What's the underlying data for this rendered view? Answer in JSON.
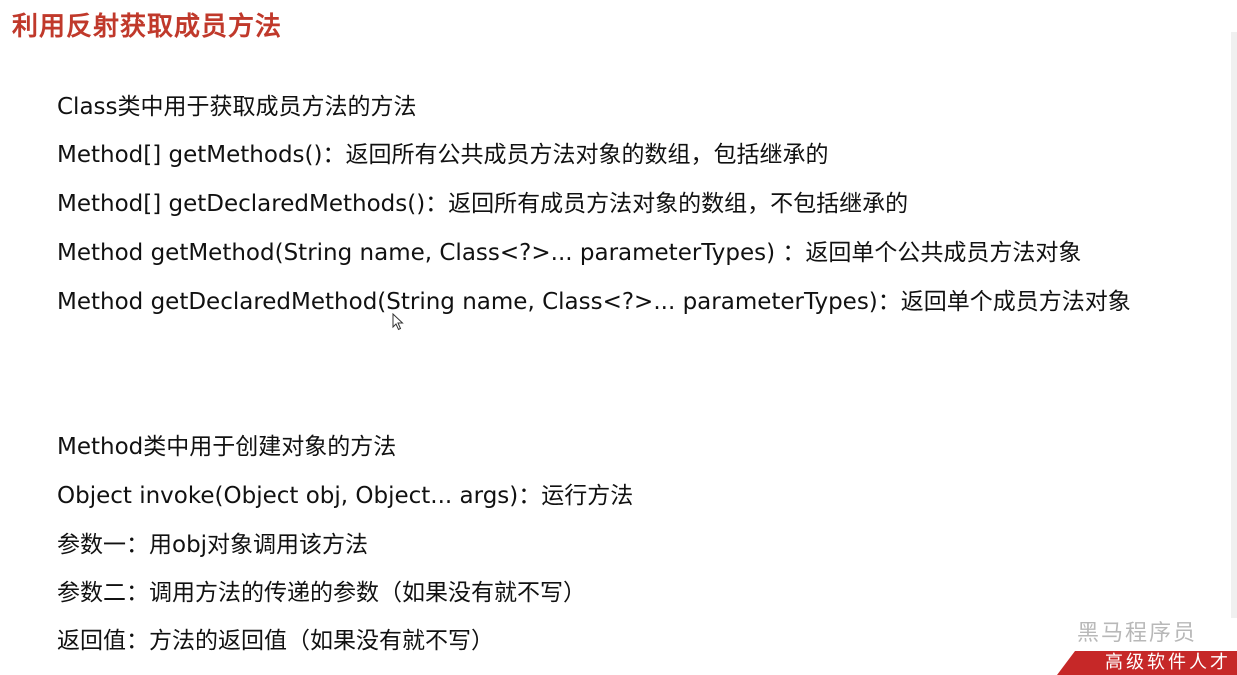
{
  "title": "利用反射获取成员方法",
  "section1": {
    "heading": "Class类中用于获取成员方法的方法",
    "lines": [
      "Method[] getMethods()：返回所有公共成员方法对象的数组，包括继承的",
      "Method[] getDeclaredMethods()：返回所有成员方法对象的数组，不包括继承的",
      "Method getMethod(String name, Class<?>... parameterTypes) ：返回单个公共成员方法对象",
      "Method getDeclaredMethod(String name, Class<?>... parameterTypes)：返回单个成员方法对象"
    ]
  },
  "section2": {
    "heading": "Method类中用于创建对象的方法",
    "lines": [
      "Object invoke(Object obj, Object... args)：运行方法",
      "参数一：用obj对象调用该方法",
      "参数二：调用方法的传递的参数（如果没有就不写）",
      "返回值：方法的返回值（如果没有就不写）"
    ]
  },
  "logo": {
    "watermark": "黑马程序员",
    "banner": "高级软件人才"
  },
  "colors": {
    "title": "#c0392b",
    "banner": "#c62828"
  }
}
